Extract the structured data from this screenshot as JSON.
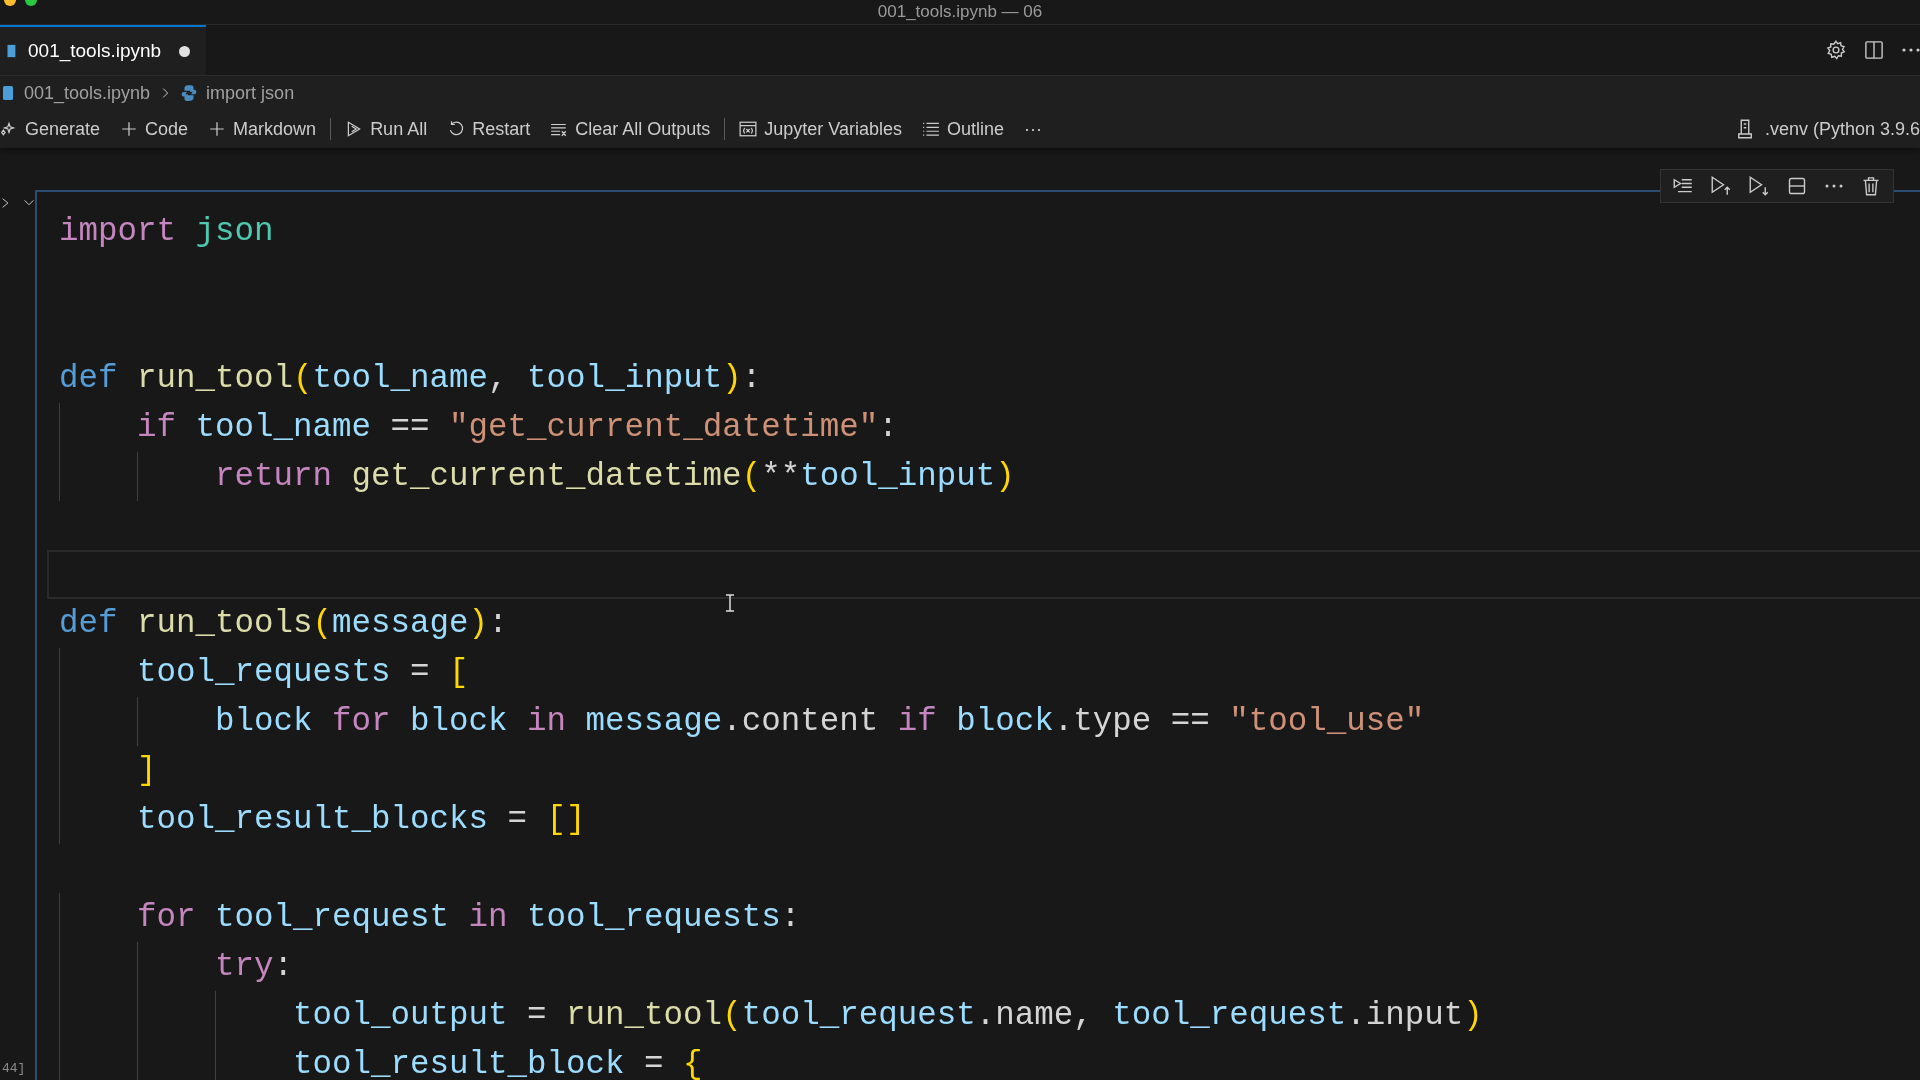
{
  "window": {
    "title": "001_tools.ipynb — 06"
  },
  "tabs": [
    {
      "label": "001_tools.ipynb",
      "selected": true,
      "modified": true
    }
  ],
  "breadcrumb": [
    "001_tools.ipynb",
    "import json"
  ],
  "toolbar": [
    {
      "kind": "button",
      "label": "Generate"
    },
    {
      "kind": "button",
      "label": "Code"
    },
    {
      "kind": "button",
      "label": "Markdown"
    },
    {
      "kind": "separator"
    },
    {
      "kind": "button",
      "label": "Run All"
    },
    {
      "kind": "button",
      "label": "Restart"
    },
    {
      "kind": "button",
      "label": "Clear All Outputs"
    },
    {
      "kind": "separator"
    },
    {
      "kind": "button",
      "label": "Jupyter Variables"
    },
    {
      "kind": "button",
      "label": "Outline"
    },
    {
      "kind": "more",
      "label": "···"
    }
  ],
  "kernel": ".venv (Python 3.9.6",
  "cell": {
    "execution_count": "44]",
    "lines": [
      {
        "current": false,
        "tokens": [
          {
            "t": "import",
            "kind": "kw"
          },
          {
            "t": " json",
            "kind": "mod"
          }
        ]
      },
      {
        "current": false
      },
      {
        "current": false
      },
      {
        "current": false,
        "tokens": [
          {
            "t": "def",
            "kind": "def"
          },
          {
            "t": " run_tool",
            "kind": "fn"
          },
          {
            "t": "(",
            "kind": "paren"
          },
          {
            "t": "tool_name",
            "kind": "var"
          },
          {
            "t": ",",
            "kind": "op"
          },
          {
            "t": " tool_input",
            "kind": "var"
          },
          {
            "t": ")",
            "kind": "paren"
          },
          {
            "t": ":",
            "kind": "op"
          }
        ]
      },
      {
        "current": false,
        "tokens": [
          {
            "t": "    if",
            "kind": "kw"
          },
          {
            "t": " tool_name",
            "kind": "var"
          },
          {
            "t": " == ",
            "kind": "op"
          },
          {
            "t": "\"get_current_datetime\"",
            "kind": "str"
          },
          {
            "t": ":",
            "kind": "op"
          }
        ]
      },
      {
        "current": false,
        "tokens": [
          {
            "t": "        return",
            "kind": "kw"
          },
          {
            "t": " get_current_datetime",
            "kind": "fn"
          },
          {
            "t": "(",
            "kind": "paren"
          },
          {
            "t": "**",
            "kind": "op"
          },
          {
            "t": "tool_input",
            "kind": "var"
          },
          {
            "t": ")",
            "kind": "paren"
          }
        ]
      },
      {
        "current": false
      },
      {
        "current": true
      },
      {
        "current": false,
        "tokens": [
          {
            "t": "def",
            "kind": "def"
          },
          {
            "t": " run_tools",
            "kind": "fn"
          },
          {
            "t": "(",
            "kind": "paren"
          },
          {
            "t": "message",
            "kind": "var"
          },
          {
            "t": ")",
            "kind": "paren"
          },
          {
            "t": ":",
            "kind": "op"
          }
        ]
      },
      {
        "current": false,
        "tokens": [
          {
            "t": "    tool_requests",
            "kind": "var"
          },
          {
            "t": " = ",
            "kind": "op"
          },
          {
            "t": "[",
            "kind": "paren"
          }
        ]
      },
      {
        "current": false,
        "tokens": [
          {
            "t": "        block",
            "kind": "var"
          },
          {
            "t": " for",
            "kind": "kw"
          },
          {
            "t": " block",
            "kind": "var"
          },
          {
            "t": " in",
            "kind": "kw"
          },
          {
            "t": " message",
            "kind": "var"
          },
          {
            "t": ".content",
            "kind": "op"
          },
          {
            "t": " if",
            "kind": "kw"
          },
          {
            "t": " block",
            "kind": "var"
          },
          {
            "t": ".type == ",
            "kind": "op"
          },
          {
            "t": "\"tool_use\"",
            "kind": "str"
          }
        ]
      },
      {
        "current": false,
        "tokens": [
          {
            "t": "    ]",
            "kind": "paren"
          }
        ]
      },
      {
        "current": false,
        "tokens": [
          {
            "t": "    tool_result_blocks",
            "kind": "var"
          },
          {
            "t": " = ",
            "kind": "op"
          },
          {
            "t": "[]",
            "kind": "paren"
          }
        ]
      },
      {
        "current": false
      },
      {
        "current": false,
        "tokens": [
          {
            "t": "    for",
            "kind": "kw"
          },
          {
            "t": " tool_request",
            "kind": "var"
          },
          {
            "t": " in",
            "kind": "kw"
          },
          {
            "t": " tool_requests",
            "kind": "var"
          },
          {
            "t": ":",
            "kind": "op"
          }
        ]
      },
      {
        "current": false,
        "tokens": [
          {
            "t": "        try",
            "kind": "kw"
          },
          {
            "t": ":",
            "kind": "op"
          }
        ]
      },
      {
        "current": false,
        "tokens": [
          {
            "t": "            tool_output",
            "kind": "var"
          },
          {
            "t": " = ",
            "kind": "op"
          },
          {
            "t": "run_tool",
            "kind": "fn"
          },
          {
            "t": "(",
            "kind": "paren"
          },
          {
            "t": "tool_request",
            "kind": "var"
          },
          {
            "t": ".name,",
            "kind": "op"
          },
          {
            "t": " tool_request",
            "kind": "var"
          },
          {
            "t": ".input",
            "kind": "op"
          },
          {
            "t": ")",
            "kind": "paren"
          }
        ]
      },
      {
        "current": false,
        "tokens": [
          {
            "t": "            tool_result_block",
            "kind": "var"
          },
          {
            "t": " = ",
            "kind": "op"
          },
          {
            "t": "{",
            "kind": "paren"
          }
        ]
      }
    ]
  }
}
